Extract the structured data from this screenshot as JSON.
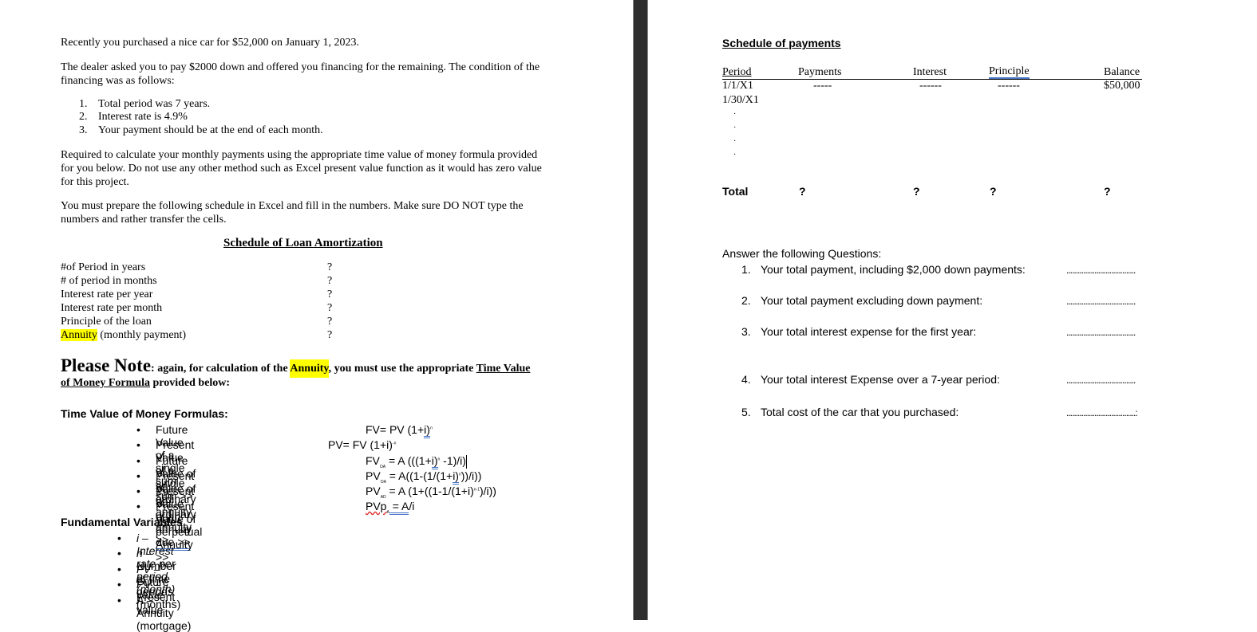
{
  "left_page": {
    "intro": "Recently you purchased a nice car for $52,000 on January 1, 2023.",
    "dealer": "The dealer asked you to pay $2000 down and offered you financing for the remaining.  The condition of the financing was as follows:",
    "conditions": [
      {
        "num": "1.",
        "text": "Total period was 7 years."
      },
      {
        "num": "2.",
        "text": "Interest rate is 4.9%"
      },
      {
        "num": "3.",
        "text": "Your payment should be at the end of each month."
      }
    ],
    "required": "Required to calculate your monthly payments using the appropriate time value of money formula provided for you below.  Do not use any other method such as Excel present value function as it would has zero value for this project.",
    "prepare": "You must prepare the following schedule in Excel and fill in the numbers.  Make sure DO NOT type the numbers and rather transfer the cells.",
    "amortization": {
      "title": "Schedule of Loan Amortization",
      "rows": [
        {
          "label": "#of Period in years",
          "value": "?"
        },
        {
          "label": "# of period in months",
          "value": "?"
        },
        {
          "label": "Interest rate per year",
          "value": "?"
        },
        {
          "label": "Interest rate per month",
          "value": "?"
        },
        {
          "label": "Principle of the loan",
          "value": "?"
        }
      ],
      "annuity_row": {
        "highlight": "Annuity",
        "rest": " (monthly payment)",
        "value": "?"
      }
    },
    "note": {
      "big": "Please Note",
      "part1": ": again, for calculation of the ",
      "highlight": "Annuity",
      "part2": ", you must use the appropriate ",
      "link1": "Time Value",
      "link2": "of Money Formula",
      "part3": " provided below:"
    },
    "tvm": {
      "title": "Time Value of Money Formulas:",
      "bullet": "•",
      "items": [
        {
          "label": "Future Value of a single sum >>"
        },
        {
          "label": "Present Value of a single sum >>"
        },
        {
          "label": "Future Value of an ordinary annuity >>"
        },
        {
          "label": "Present Value of an ordinary annuity >>"
        },
        {
          "label_a": "Present Value of an annuity ",
          "label_due": "due  >>"
        },
        {
          "label": "Present Value of perpetual Annuity >>"
        }
      ],
      "formulas": {
        "f1": {
          "a": "FV= PV (1+",
          "b": "i)",
          "sup": "n"
        },
        "f2": {
          "a": "PV= FV (1+i)",
          "sup": "-n"
        },
        "f3": {
          "a": "FV",
          "sub": "OA",
          "b": " = A (((1+",
          "c": "i)",
          "sup": "n",
          "d": " -1)/i)"
        },
        "f4": {
          "a": "PV",
          "sub": "OA",
          "b": " = A((1-(1/(1+",
          "c": "i)",
          "sup": "n",
          "d": "))/i))"
        },
        "f5": {
          "a": "PV",
          "sub": "AD",
          "b": " = A (1+((1-1/(1+i)",
          "sup": "n-1",
          "d": ")/i))"
        },
        "f6": {
          "a": "PVp",
          "sub": "A",
          "b": " =  A",
          "c": "/i"
        }
      }
    },
    "fundamental": {
      "title": "Fundamental Variables",
      "items": [
        {
          "sym": "i",
          "desc": " – Interest rate per period (month)",
          "italic_all": true
        },
        {
          "sym": "n",
          "desc": " – Number of time periods (months)",
          "italic_all": false
        },
        {
          "sym": "FV",
          "desc": " – Future value",
          "italic_all": false
        },
        {
          "sym": "PV",
          "desc": " – Present value",
          "italic_all": false
        },
        {
          "sym": "A",
          "desc": " – Annuity (mortgage)",
          "italic_all": false
        }
      ]
    }
  },
  "right_page": {
    "schedule": {
      "title": "Schedule of payments",
      "headers": [
        "Period",
        "Payments",
        "Interest",
        "Principle",
        "Balance"
      ],
      "rows": [
        {
          "period": "1/1/X1",
          "payments": "-----",
          "interest": "------",
          "principle": "------",
          "balance": "$50,000"
        },
        {
          "period": "1/30/X1",
          "payments": "",
          "interest": "",
          "principle": "",
          "balance": ""
        }
      ],
      "ellipsis_dot": "·",
      "total": {
        "label": "Total",
        "payments": "?",
        "interest": "?",
        "principle": "?",
        "balance": "?"
      }
    },
    "questions": {
      "title": "Answer the following Questions:",
      "items": [
        {
          "num": "1.",
          "text": "Your total payment, including $2,000 down payments:",
          "answer": "....................................."
        },
        {
          "num": "2.",
          "text": "Your total payment excluding down payment:",
          "answer": "....................................."
        },
        {
          "num": "3.",
          "text": "Your total interest expense for the first year:",
          "answer": "....................................."
        },
        {
          "num": "4.",
          "text": "Your total interest Expense over a 7-year period:",
          "answer": "....................................."
        },
        {
          "num": "5.",
          "text": "Total cost of the car that you purchased:",
          "answer": ".....................................:"
        }
      ]
    }
  },
  "colors": {
    "highlight": "#ffff00",
    "divider": "#2e2e2e",
    "spell_underline": "#4472c4",
    "spell_error": "#e03030"
  }
}
